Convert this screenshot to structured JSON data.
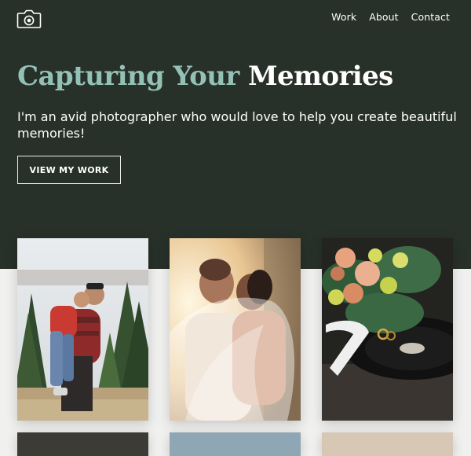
{
  "nav": {
    "items": [
      "Work",
      "About",
      "Contact"
    ]
  },
  "hero": {
    "title_accent": "Capturing Your",
    "title_rest": "Memories",
    "subtitle": "I'm an avid photographer who would love to help you create beautiful memories!",
    "cta_label": "VIEW MY WORK"
  },
  "icons": {
    "logo": "camera-icon"
  },
  "colors": {
    "hero_bg": "#273029",
    "accent": "#93c1b6",
    "page_bg": "#f0f0ef",
    "text_light": "#ffffff"
  },
  "gallery": {
    "photos": [
      {
        "name": "family-christmas-tree-farm-photo"
      },
      {
        "name": "wedding-couple-kiss-photo"
      },
      {
        "name": "bouquet-rings-vinyl-record-photo"
      }
    ]
  }
}
